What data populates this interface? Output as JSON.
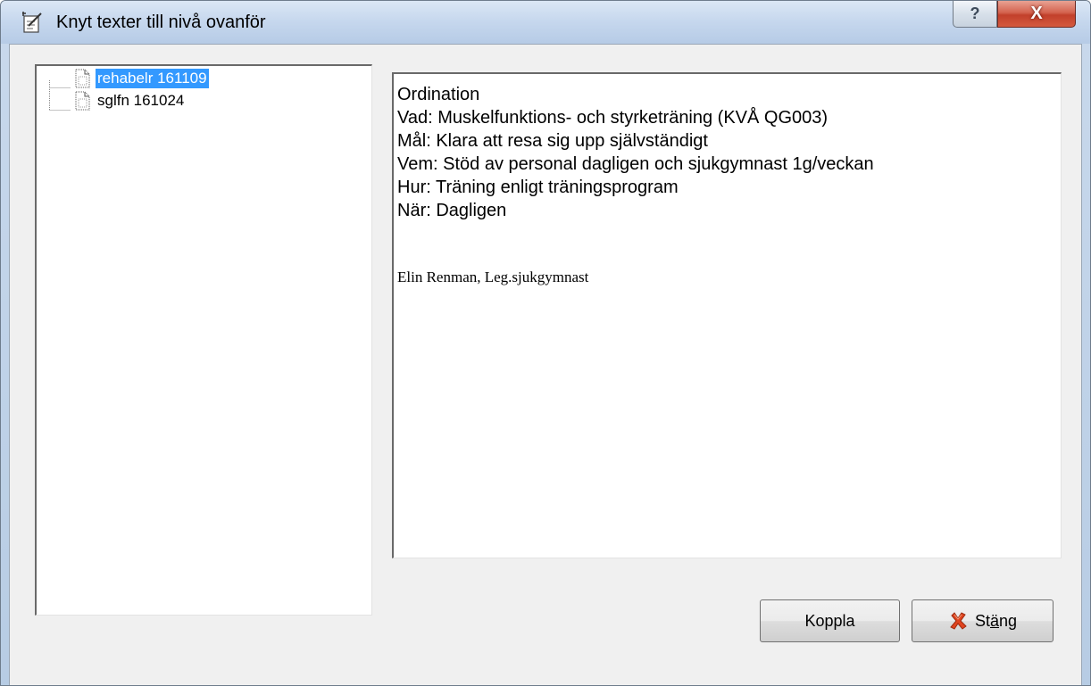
{
  "window": {
    "title": "Knyt texter till nivå ovanför",
    "help_button": "?",
    "close_button": "X"
  },
  "tree": {
    "items": [
      {
        "label": "rehabelr 161109",
        "selected": true
      },
      {
        "label": "sglfn 161024",
        "selected": false
      }
    ]
  },
  "content": {
    "lines": [
      "Ordination",
      "Vad: Muskelfunktions- och styrketräning (KVÅ QG003)",
      "Mål: Klara att resa sig upp självständigt",
      "Vem: Stöd av personal dagligen och sjukgymnast 1g/veckan",
      "Hur: Träning enligt träningsprogram",
      "När: Dagligen"
    ],
    "signature": "Elin Renman, Leg.sjukgymnast"
  },
  "buttons": {
    "koppla": "Koppla",
    "stang_prefix": "St",
    "stang_underlined": "ä",
    "stang_suffix": "ng"
  },
  "colors": {
    "selection": "#3399ff",
    "close_button": "#c2402b"
  }
}
